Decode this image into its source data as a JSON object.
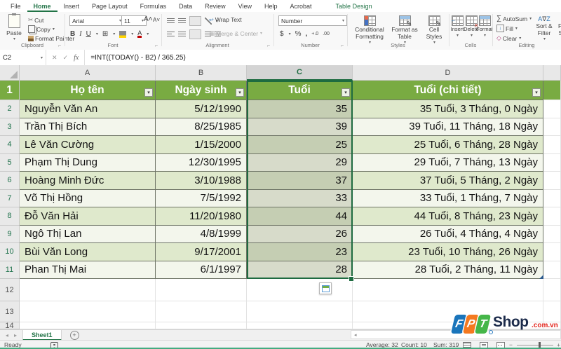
{
  "ribbon": {
    "tabs": [
      "File",
      "Home",
      "Insert",
      "Page Layout",
      "Formulas",
      "Data",
      "Review",
      "View",
      "Help",
      "Acrobat",
      "Table Design"
    ],
    "active_tab": "Home",
    "contextual_tab": "Table Design",
    "clipboard": {
      "paste": "Paste",
      "cut": "Cut",
      "copy": "Copy",
      "format_painter": "Format Painter",
      "group": "Clipboard"
    },
    "font": {
      "name": "Arial",
      "size": "11",
      "group": "Font"
    },
    "alignment": {
      "wrap": "Wrap Text",
      "merge": "Merge & Center",
      "group": "Alignment"
    },
    "number": {
      "format": "Number",
      "group": "Number"
    },
    "styles": {
      "conditional": "Conditional Formatting",
      "format_table": "Format as Table",
      "cell_styles": "Cell Styles",
      "group": "Styles"
    },
    "cells": {
      "insert": "Insert",
      "del": "Delete",
      "format": "Format",
      "group": "Cells"
    },
    "editing": {
      "autosum": "AutoSum",
      "fill": "Fill",
      "clear": "Clear",
      "sort": "Sort & Filter",
      "find": "Find & Select",
      "group": "Editing"
    }
  },
  "formula_bar": {
    "name_box": "C2",
    "formula": "=INT((TODAY() - B2) / 365.25)"
  },
  "grid": {
    "col_letters": [
      "A",
      "B",
      "C",
      "D"
    ],
    "selected_col": "C",
    "table_headers": [
      "Họ tên",
      "Ngày sinh",
      "Tuổi",
      "Tuổi (chi tiết)"
    ],
    "rows": [
      {
        "num": "2",
        "name": "Nguyễn Văn An",
        "birth": "5/12/1990",
        "age": "35",
        "detail": "35 Tuổi, 3 Tháng, 0 Ngày"
      },
      {
        "num": "3",
        "name": "Trần Thị Bích",
        "birth": "8/25/1985",
        "age": "39",
        "detail": "39 Tuổi, 11 Tháng, 18 Ngày"
      },
      {
        "num": "4",
        "name": "Lê Văn Cường",
        "birth": "1/15/2000",
        "age": "25",
        "detail": "25 Tuổi, 6 Tháng, 28 Ngày"
      },
      {
        "num": "5",
        "name": "Phạm Thị Dung",
        "birth": "12/30/1995",
        "age": "29",
        "detail": "29 Tuổi, 7 Tháng, 13 Ngày"
      },
      {
        "num": "6",
        "name": "Hoàng Minh Đức",
        "birth": "3/10/1988",
        "age": "37",
        "detail": "37 Tuổi, 5 Tháng, 2 Ngày"
      },
      {
        "num": "7",
        "name": "Võ Thị Hồng",
        "birth": "7/5/1992",
        "age": "33",
        "detail": "33 Tuổi, 1 Tháng, 7 Ngày"
      },
      {
        "num": "8",
        "name": "Đỗ Văn Hải",
        "birth": "11/20/1980",
        "age": "44",
        "detail": "44 Tuổi, 8 Tháng, 23 Ngày"
      },
      {
        "num": "9",
        "name": "Ngô Thị Lan",
        "birth": "4/8/1999",
        "age": "26",
        "detail": "26 Tuổi, 4 Tháng, 4 Ngày"
      },
      {
        "num": "10",
        "name": "Bùi Văn Long",
        "birth": "9/17/2001",
        "age": "23",
        "detail": "23 Tuổi, 10 Tháng, 26 Ngày"
      },
      {
        "num": "11",
        "name": "Phan Thị Mai",
        "birth": "6/1/1997",
        "age": "28",
        "detail": "28 Tuổi, 2 Tháng, 11 Ngày"
      }
    ],
    "empty_row_nums": [
      "12",
      "13",
      "14"
    ]
  },
  "sheet_bar": {
    "sheet": "Sheet1"
  },
  "status_bar": {
    "mode": "Ready",
    "average": "Average: 32",
    "count": "Count: 10",
    "sum": "Sum: 319"
  },
  "watermark": {
    "f": "F",
    "p": "P",
    "t": "T",
    "shop": "Shop",
    "domain": ".com.vn",
    "f_color": "#1a75bb",
    "p_color": "#f47920",
    "t_color": "#45b649",
    "shop_color": "#1b2a4a",
    "domain_color": "#e2231a"
  },
  "colors": {
    "accent_green": "#217346",
    "table_header": "#79ab42",
    "band_dark": "#dfe9cc",
    "band_light": "#f3f6ec",
    "selected_band_dark": "#c5ceb3",
    "selected_band_light": "#d7dbca",
    "selection_border": "#1e6b40"
  }
}
